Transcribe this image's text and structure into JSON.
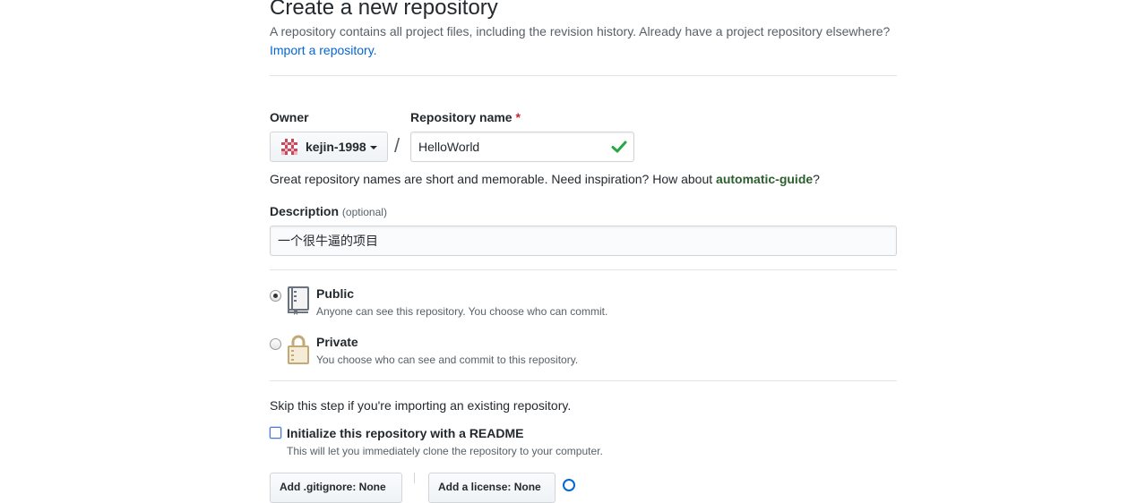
{
  "page": {
    "title": "Create a new repository",
    "subtitle": "A repository contains all project files, including the revision history. Already have a project repository elsewhere?",
    "import_link": "Import a repository."
  },
  "owner": {
    "label": "Owner",
    "name": "kejin-1998"
  },
  "repo_name": {
    "label": "Repository name",
    "required_mark": "*",
    "value": "HelloWorld",
    "separator": "/"
  },
  "hint": {
    "text": "Great repository names are short and memorable. Need inspiration? How about ",
    "suggestion": "automatic-guide",
    "end": "?"
  },
  "description": {
    "label": "Description",
    "optional": "(optional)",
    "value": "一个很牛逼的项目"
  },
  "visibility": {
    "public": {
      "title": "Public",
      "note": "Anyone can see this repository. You choose who can commit.",
      "selected": true
    },
    "private": {
      "title": "Private",
      "note": "You choose who can see and commit to this repository.",
      "selected": false
    }
  },
  "init": {
    "skip_text": "Skip this step if you're importing an existing repository.",
    "readme_label": "Initialize this repository with a README",
    "readme_note": "This will let you immediately clone the repository to your computer.",
    "readme_checked": false
  },
  "selects": {
    "gitignore": "Add .gitignore: None",
    "license": "Add a license: None"
  },
  "colors": {
    "link": "#0366d6",
    "required": "#cb2431",
    "valid": "#28a745",
    "muted": "#586069"
  }
}
